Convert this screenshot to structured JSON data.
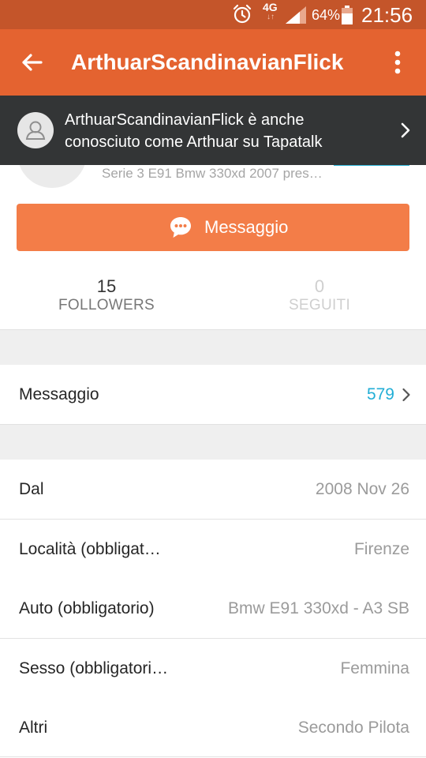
{
  "status_bar": {
    "network": "4G",
    "network_arrows": "↓↑",
    "battery_percent": "64%",
    "time": "21:56"
  },
  "app_bar": {
    "title": "ArthuarScandinavianFlick"
  },
  "notice": {
    "text": "ArthuarScandinavianFlick è anche conosciuto come Arthuar su Tapatalk"
  },
  "profile": {
    "subtitle": "Serie 3 E91 Bmw 330xd 2007 pres…"
  },
  "message_button": {
    "label": "Messaggio"
  },
  "stats": {
    "followers": {
      "count": "15",
      "label": "FOLLOWERS"
    },
    "following": {
      "count": "0",
      "label": "SEGUITI"
    }
  },
  "messages_row": {
    "label": "Messaggio",
    "value": "579"
  },
  "details": [
    {
      "label": "Dal",
      "value": "2008 Nov 26"
    },
    {
      "label": "Località (obbligat…",
      "value": "Firenze"
    },
    {
      "label": "Auto (obbligatorio)",
      "value": "Bmw E91 330xd - A3 SB"
    },
    {
      "label": "Sesso (obbligatori…",
      "value": "Femmina"
    },
    {
      "label": "Altri",
      "value": "Secondo Pilota"
    }
  ],
  "colors": {
    "status_bar": "#c4552a",
    "app_bar": "#e46330",
    "notice_bg": "#333536",
    "button": "#f37d48",
    "link": "#22aed6"
  },
  "icons": {
    "alarm": "alarm-clock-icon",
    "signal": "signal-strength-icon",
    "battery": "battery-icon",
    "back": "arrow-back-icon",
    "more": "more-vertical-icon",
    "user": "user-avatar-icon",
    "chevron": "chevron-right-icon",
    "chat": "chat-bubble-icon"
  }
}
